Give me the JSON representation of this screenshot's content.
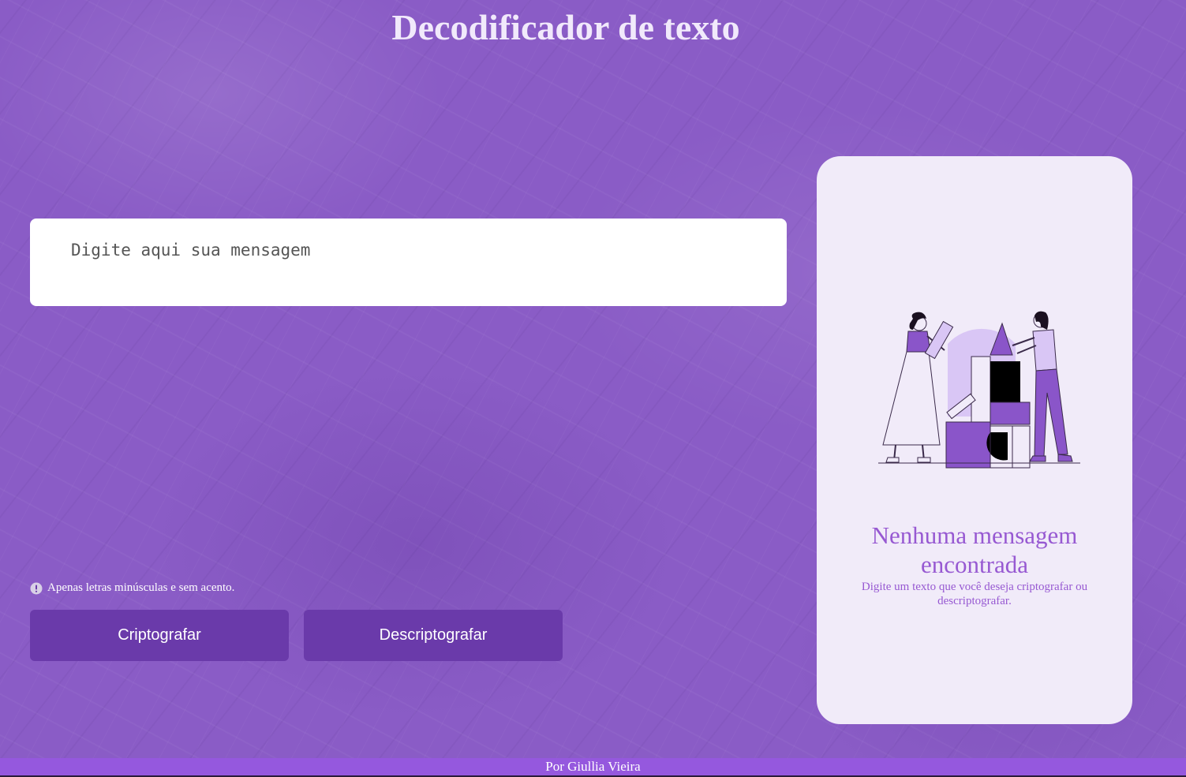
{
  "header": {
    "title": "Decodificador de texto"
  },
  "input": {
    "placeholder": "Digite aqui sua mensagem"
  },
  "hint": {
    "icon": "info-exclamation-icon",
    "text": "Apenas letras minúsculas e sem acento."
  },
  "buttons": {
    "encrypt_label": "Criptografar",
    "decrypt_label": "Descriptografar"
  },
  "output": {
    "illustration": "people-building-blocks-illustration",
    "empty_title": "Nenhuma mensagem encontrada",
    "empty_subtitle": "Digite um texto que você deseja criptografar ou descriptografar."
  },
  "footer": {
    "text": "Por Giullia Vieira"
  },
  "colors": {
    "background": "#8a5cc6",
    "button": "#6a3aaa",
    "card": "#f1ebf9",
    "accent_text": "#9759d2",
    "footer": "#9558de",
    "title": "#f1e9fb"
  }
}
